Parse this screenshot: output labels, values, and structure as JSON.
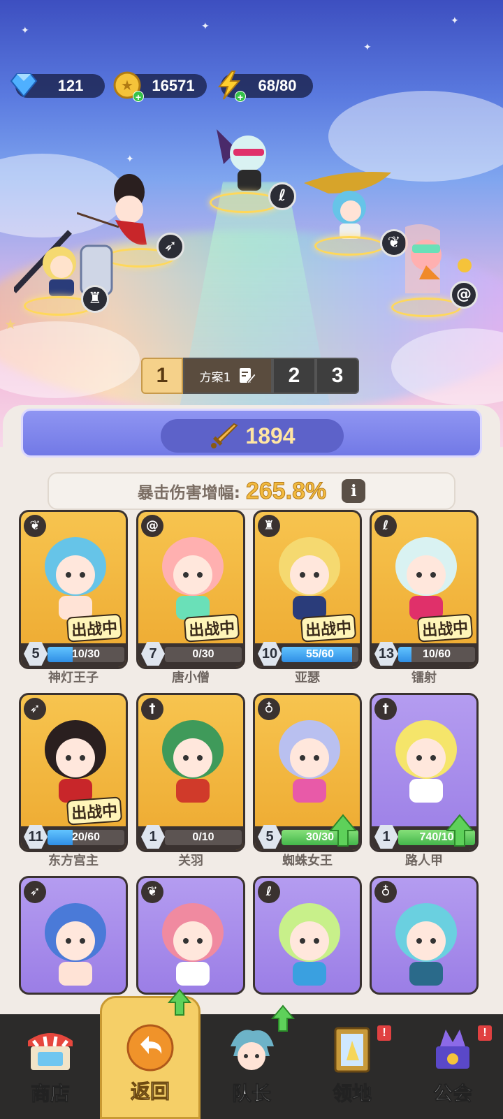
{
  "resources": {
    "gems": "121",
    "gold": "16571",
    "energy": "68/80"
  },
  "plans": {
    "active_number": "1",
    "active_name": "方案1",
    "other_numbers": [
      "2",
      "3"
    ]
  },
  "power": {
    "value": "1894"
  },
  "crit": {
    "label": "暴击伤害增幅:",
    "value": "265.8%"
  },
  "in_battle_label": "出战中",
  "cards": [
    {
      "name": "神灯王子",
      "level": "5",
      "progress": "10/30",
      "fill": 0.33,
      "in_battle": true,
      "upgrade": false,
      "class_icon": "wing-icon",
      "bg": "gold"
    },
    {
      "name": "唐小僧",
      "level": "7",
      "progress": "0/30",
      "fill": 0.0,
      "in_battle": true,
      "upgrade": false,
      "class_icon": "spiral-icon",
      "bg": "gold"
    },
    {
      "name": "亚瑟",
      "level": "10",
      "progress": "55/60",
      "fill": 0.92,
      "in_battle": true,
      "upgrade": false,
      "class_icon": "helmet-icon",
      "bg": "gold"
    },
    {
      "name": "镭射",
      "level": "13",
      "progress": "10/60",
      "fill": 0.17,
      "in_battle": true,
      "upgrade": false,
      "class_icon": "magic-icon",
      "bg": "gold"
    },
    {
      "name": "东方宫主",
      "level": "11",
      "progress": "20/60",
      "fill": 0.33,
      "in_battle": true,
      "upgrade": false,
      "class_icon": "bow-icon",
      "bg": "gold"
    },
    {
      "name": "关羽",
      "level": "1",
      "progress": "0/10",
      "fill": 0.0,
      "in_battle": false,
      "upgrade": false,
      "class_icon": "sword-icon",
      "bg": "gold"
    },
    {
      "name": "蜘蛛女王",
      "level": "5",
      "progress": "30/30",
      "fill": 1.0,
      "in_battle": false,
      "upgrade": true,
      "class_icon": "potion-icon",
      "bg": "gold"
    },
    {
      "name": "路人甲",
      "level": "1",
      "progress": "740/10",
      "fill": 1.0,
      "in_battle": false,
      "upgrade": true,
      "class_icon": "sword-icon",
      "bg": "purple"
    },
    {
      "name": "",
      "level": "",
      "progress": "",
      "fill": 0,
      "in_battle": false,
      "upgrade": false,
      "class_icon": "bow-icon",
      "bg": "purple"
    },
    {
      "name": "",
      "level": "",
      "progress": "",
      "fill": 0,
      "in_battle": false,
      "upgrade": false,
      "class_icon": "wing-icon",
      "bg": "purple"
    },
    {
      "name": "",
      "level": "",
      "progress": "",
      "fill": 0,
      "in_battle": false,
      "upgrade": false,
      "class_icon": "magic-icon",
      "bg": "purple"
    },
    {
      "name": "",
      "level": "",
      "progress": "",
      "fill": 0,
      "in_battle": false,
      "upgrade": false,
      "class_icon": "potion-icon",
      "bg": "purple"
    }
  ],
  "nav": [
    {
      "label": "商店",
      "icon": "shop-icon",
      "active": false,
      "alert": false,
      "upgrade": false
    },
    {
      "label": "返回",
      "icon": "back-arrow-icon",
      "active": true,
      "alert": false,
      "upgrade": true
    },
    {
      "label": "队长",
      "icon": "captain-icon",
      "active": false,
      "alert": false,
      "upgrade": true
    },
    {
      "label": "领地",
      "icon": "territory-icon",
      "active": false,
      "alert": true,
      "upgrade": false
    },
    {
      "label": "公会",
      "icon": "guild-icon",
      "active": false,
      "alert": true,
      "upgrade": false
    }
  ],
  "alert_mark": "!",
  "colors": {
    "gold_card": "#f2b63d",
    "purple_card": "#a88cec",
    "power_bar": "#7f85ec",
    "crit_value": "#f3bb3f",
    "progress_blue": "#3a9be8",
    "progress_green": "#4fbf55",
    "nav_bg": "#2c2b2a",
    "nav_active": "#f5cf67"
  }
}
